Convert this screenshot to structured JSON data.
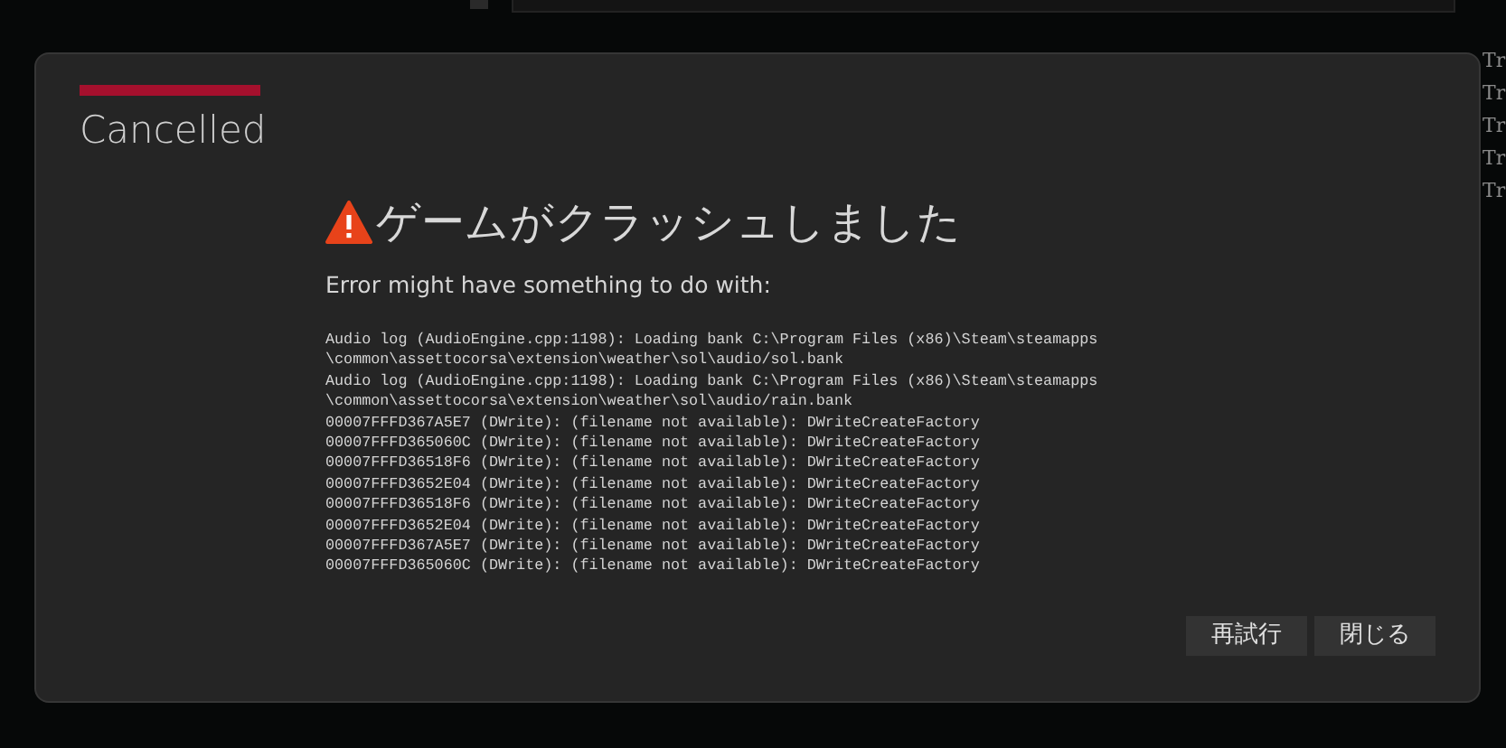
{
  "background": {
    "side_items": [
      "Tr",
      "Tr",
      "Tr",
      "Tr",
      "Tr"
    ]
  },
  "dialog": {
    "status": "Cancelled",
    "title": "ゲームがクラッシュしました",
    "subtitle": "Error might have something to do with:",
    "log_lines": [
      "Audio log (AudioEngine.cpp:1198): Loading bank C:\\Program Files (x86)\\Steam\\steamapps",
      "\\common\\assettocorsa\\extension\\weather\\sol\\audio/sol.bank",
      "Audio log (AudioEngine.cpp:1198): Loading bank C:\\Program Files (x86)\\Steam\\steamapps",
      "\\common\\assettocorsa\\extension\\weather\\sol\\audio/rain.bank",
      "00007FFFD367A5E7 (DWrite): (filename not available): DWriteCreateFactory",
      "00007FFFD365060C (DWrite): (filename not available): DWriteCreateFactory",
      "00007FFFD36518F6 (DWrite): (filename not available): DWriteCreateFactory",
      "00007FFFD3652E04 (DWrite): (filename not available): DWriteCreateFactory",
      "00007FFFD36518F6 (DWrite): (filename not available): DWriteCreateFactory",
      "00007FFFD3652E04 (DWrite): (filename not available): DWriteCreateFactory",
      "00007FFFD367A5E7 (DWrite): (filename not available): DWriteCreateFactory",
      "00007FFFD365060C (DWrite): (filename not available): DWriteCreateFactory"
    ],
    "buttons": [
      "再試行",
      "閉じる"
    ]
  }
}
